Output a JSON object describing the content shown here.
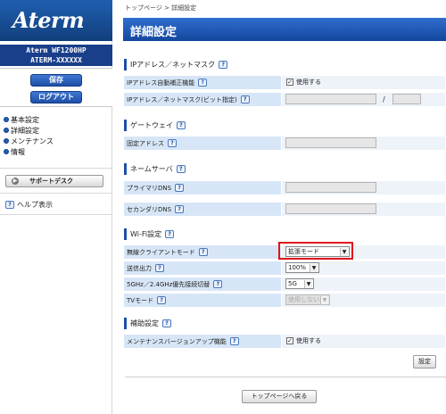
{
  "sidebar": {
    "logo": "Aterm",
    "model_line1": "Aterm WF1200HP",
    "model_line2": "ATERM-XXXXXX",
    "save_label": "保存",
    "logout_label": "ログアウト",
    "menu": [
      {
        "label": "基本設定"
      },
      {
        "label": "詳細設定"
      },
      {
        "label": "メンテナンス"
      },
      {
        "label": "情報"
      }
    ],
    "support_label": "サポートデスク",
    "help_label": "ヘルプ表示"
  },
  "breadcrumb": "トップページ > 詳細設定",
  "page_title": "詳細設定",
  "help_glyph": "?",
  "sections": {
    "ip": {
      "title": "IPアドレス／ネットマスク",
      "auto_label": "IPアドレス自動補正機能",
      "auto_value": "使用する",
      "auto_checked": true,
      "addr_label": "IPアドレス／ネットマスク(ビット指定)",
      "slash": "/"
    },
    "gateway": {
      "title": "ゲートウェイ",
      "fixed_label": "固定アドレス"
    },
    "dns": {
      "title": "ネームサーバ",
      "primary_label": "プライマリDNS",
      "secondary_label": "セカンダリDNS"
    },
    "wifi": {
      "title": "Wi-Fi設定",
      "client_mode_label": "無線クライアントモード",
      "client_mode_value": "拡張モード",
      "tx_power_label": "送信出力",
      "tx_power_value": "100%",
      "band_label": "5GHz／2.4GHz優先接続切替",
      "band_value": "5G",
      "tv_mode_label": "TVモード",
      "tv_mode_value": "使用しない"
    },
    "aux": {
      "title": "補助設定",
      "maint_label": "メンテナンスバージョンアップ機能",
      "maint_value": "使用する",
      "maint_checked": true
    }
  },
  "set_button": "設定",
  "back_button": "トップページへ戻る"
}
